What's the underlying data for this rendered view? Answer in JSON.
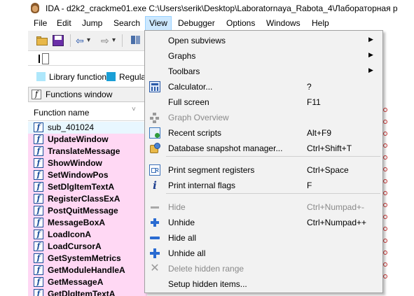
{
  "window": {
    "title": "IDA - d2k2_crackme01.exe C:\\Users\\serik\\Desktop\\Laboratornaya_Rabota_4\\Лабораторная р"
  },
  "menubar": {
    "items": [
      {
        "label": "File"
      },
      {
        "label": "Edit"
      },
      {
        "label": "Jump"
      },
      {
        "label": "Search"
      },
      {
        "label": "View"
      },
      {
        "label": "Debugger"
      },
      {
        "label": "Options"
      },
      {
        "label": "Windows"
      },
      {
        "label": "Help"
      }
    ],
    "active": "View"
  },
  "toolbar": {
    "back_arrow": "⇦",
    "forward_arrow": "⇨",
    "dropdown_arrow": "▾"
  },
  "legend": {
    "items": [
      {
        "label": "Library function",
        "color": "#aee7fb"
      },
      {
        "label": "Regular",
        "color": "#1a9fd6"
      }
    ]
  },
  "functions_window": {
    "title": "Functions window",
    "icon_glyph": "f",
    "column_header": "Function name",
    "sort_glyph": "˅",
    "rows": [
      {
        "name": "sub_401024",
        "kind": "library"
      },
      {
        "name": "UpdateWindow",
        "kind": "import"
      },
      {
        "name": "TranslateMessage",
        "kind": "import"
      },
      {
        "name": "ShowWindow",
        "kind": "import"
      },
      {
        "name": "SetWindowPos",
        "kind": "import"
      },
      {
        "name": "SetDlgItemTextA",
        "kind": "import"
      },
      {
        "name": "RegisterClassExA",
        "kind": "import"
      },
      {
        "name": "PostQuitMessage",
        "kind": "import"
      },
      {
        "name": "MessageBoxA",
        "kind": "import"
      },
      {
        "name": "LoadIconA",
        "kind": "import"
      },
      {
        "name": "LoadCursorA",
        "kind": "import"
      },
      {
        "name": "GetSystemMetrics",
        "kind": "import"
      },
      {
        "name": "GetModuleHandleA",
        "kind": "import"
      },
      {
        "name": "GetMessageA",
        "kind": "import"
      },
      {
        "name": "GetDlgItemTextA",
        "kind": "import"
      }
    ]
  },
  "view_menu": {
    "items": [
      {
        "label": "Open subviews",
        "shortcut": "",
        "submenu": true,
        "enabled": true,
        "icon": ""
      },
      {
        "label": "Graphs",
        "shortcut": "",
        "submenu": true,
        "enabled": true,
        "icon": ""
      },
      {
        "label": "Toolbars",
        "shortcut": "",
        "submenu": true,
        "enabled": true,
        "icon": ""
      },
      {
        "label": "Calculator...",
        "shortcut": "?",
        "submenu": false,
        "enabled": true,
        "icon": "calculator-icon"
      },
      {
        "label": "Full screen",
        "shortcut": "F11",
        "submenu": false,
        "enabled": true,
        "icon": ""
      },
      {
        "label": "Graph Overview",
        "shortcut": "",
        "submenu": false,
        "enabled": false,
        "icon": "graph-overview-icon"
      },
      {
        "label": "Recent scripts",
        "shortcut": "Alt+F9",
        "submenu": false,
        "enabled": true,
        "icon": "recent-scripts-icon"
      },
      {
        "label": "Database snapshot manager...",
        "shortcut": "Ctrl+Shift+T",
        "submenu": false,
        "enabled": true,
        "icon": "snapshot-icon"
      },
      {
        "separator": true
      },
      {
        "label": "Print segment registers",
        "shortcut": "Ctrl+Space",
        "submenu": false,
        "enabled": true,
        "icon": "segment-registers-icon"
      },
      {
        "label": "Print internal flags",
        "shortcut": "F",
        "submenu": false,
        "enabled": true,
        "icon": "info-icon"
      },
      {
        "separator": true
      },
      {
        "label": "Hide",
        "shortcut": "Ctrl+Numpad+-",
        "submenu": false,
        "enabled": false,
        "icon": "hide-icon"
      },
      {
        "label": "Unhide",
        "shortcut": "Ctrl+Numpad++",
        "submenu": false,
        "enabled": true,
        "icon": "unhide-icon"
      },
      {
        "label": "Hide all",
        "shortcut": "",
        "submenu": false,
        "enabled": true,
        "icon": "hide-all-icon"
      },
      {
        "label": "Unhide all",
        "shortcut": "",
        "submenu": false,
        "enabled": true,
        "icon": "unhide-all-icon"
      },
      {
        "label": "Delete hidden range",
        "shortcut": "",
        "submenu": false,
        "enabled": false,
        "icon": "delete-range-icon"
      },
      {
        "label": "Setup hidden items...",
        "shortcut": "",
        "submenu": false,
        "enabled": true,
        "icon": ""
      }
    ],
    "submenu_arrow": "▶"
  },
  "colors": {
    "library_row": "#e8f7ff",
    "import_row": "#ffd8f4",
    "menu_highlight": "#cce8ff",
    "menu_bg": "#f2f2f2"
  }
}
